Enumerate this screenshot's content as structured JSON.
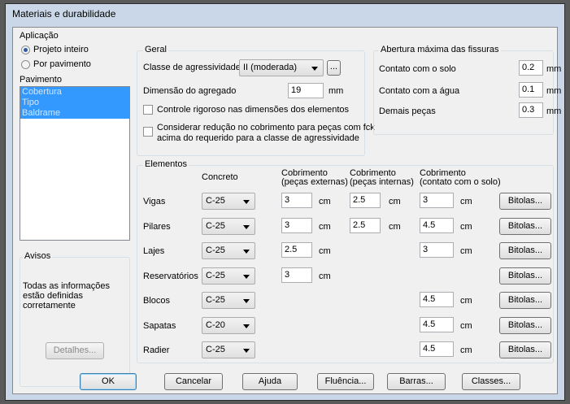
{
  "window": {
    "title": "Materiais e durabilidade"
  },
  "aplicacao": {
    "label": "Aplicação",
    "option1": "Projeto inteiro",
    "option2": "Por pavimento",
    "selected": "Projeto inteiro"
  },
  "pavimento": {
    "label": "Pavimento",
    "items": [
      "Cobertura",
      "Tipo",
      "Baldrame"
    ]
  },
  "avisos": {
    "label": "Avisos",
    "message": "Todas as informações estão definidas corretamente",
    "details_button": "Detalhes..."
  },
  "geral": {
    "label": "Geral",
    "classe_label": "Classe de agressividade",
    "classe_value": "II (moderada)",
    "ellipsis": "...",
    "dimensao_label": "Dimensão do agregado",
    "dimensao_value": "19",
    "dimensao_unit": "mm",
    "check1": "Controle rigoroso nas dimensões dos elementos",
    "check2_line1": "Considerar redução no cobrimento para peças com fck",
    "check2_line2": "acima do requerido para a classe de agressividade"
  },
  "abertura": {
    "label": "Abertura máxima das fissuras",
    "rows": [
      {
        "label": "Contato com o solo",
        "value": "0.2",
        "unit": "mm"
      },
      {
        "label": "Contato com a água",
        "value": "0.1",
        "unit": "mm"
      },
      {
        "label": "Demais peças",
        "value": "0.3",
        "unit": "mm"
      }
    ]
  },
  "elementos": {
    "label": "Elementos",
    "headers": {
      "concreto": "Concreto",
      "cob_ext_1": "Cobrimento",
      "cob_ext_2": "(peças externas)",
      "cob_int_1": "Cobrimento",
      "cob_int_2": "(peças internas)",
      "cob_solo_1": "Cobrimento",
      "cob_solo_2": "(contato com o solo)"
    },
    "unit": "cm",
    "bitolas": "Bitolas...",
    "rows": [
      {
        "name": "Vigas",
        "concreto": "C-25",
        "ext": "3",
        "int": "2.5",
        "solo": "3"
      },
      {
        "name": "Pilares",
        "concreto": "C-25",
        "ext": "3",
        "int": "2.5",
        "solo": "4.5"
      },
      {
        "name": "Lajes",
        "concreto": "C-25",
        "ext": "2.5",
        "int": "",
        "solo": "3"
      },
      {
        "name": "Reservatórios",
        "concreto": "C-25",
        "ext": "3",
        "int": "",
        "solo": ""
      },
      {
        "name": "Blocos",
        "concreto": "C-25",
        "ext": "",
        "int": "",
        "solo": "4.5"
      },
      {
        "name": "Sapatas",
        "concreto": "C-20",
        "ext": "",
        "int": "",
        "solo": "4.5"
      },
      {
        "name": "Radier",
        "concreto": "C-25",
        "ext": "",
        "int": "",
        "solo": "4.5"
      }
    ]
  },
  "buttons": {
    "ok": "OK",
    "cancelar": "Cancelar",
    "ajuda": "Ajuda",
    "fluencia": "Fluência...",
    "barras": "Barras...",
    "classes": "Classes..."
  }
}
